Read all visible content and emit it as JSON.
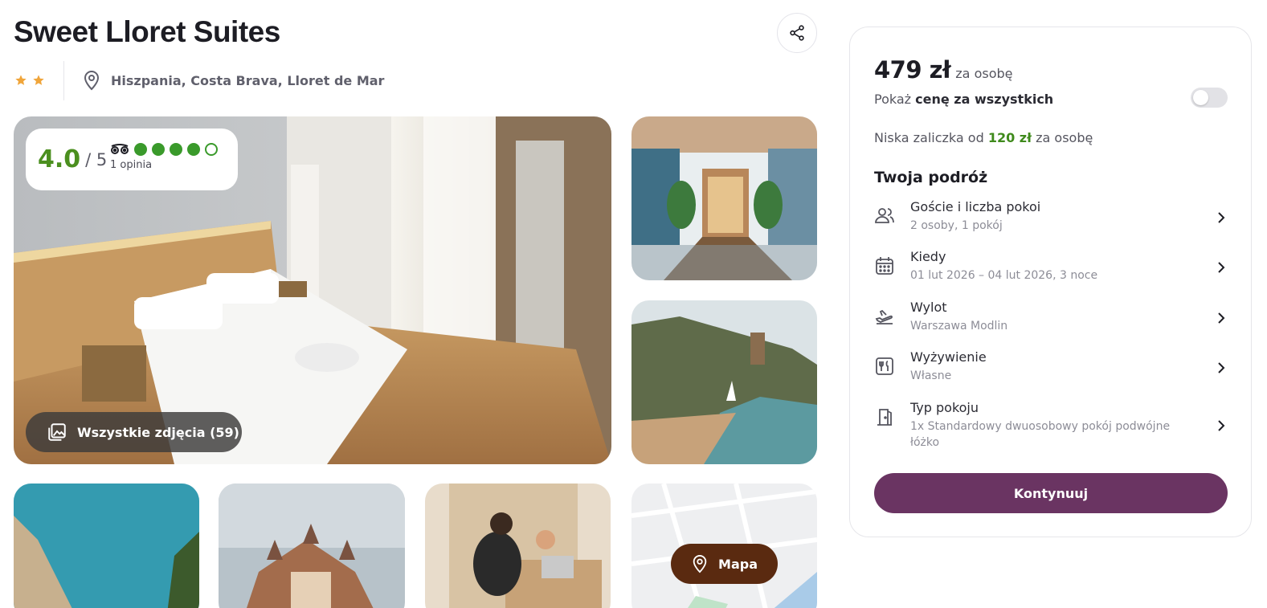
{
  "header": {
    "hotel_name": "Sweet Lloret Suites",
    "star_count": 2,
    "location": "Hiszpania, Costa Brava, Lloret de Mar"
  },
  "gallery": {
    "rating_value": "4.0",
    "rating_scale": "/ 5",
    "tripadvisor_bubbles": 4,
    "tripadvisor_reviews": "1 opinia",
    "all_photos_label": "Wszystkie zdjęcia (59)",
    "map_label": "Mapa"
  },
  "booking": {
    "price": "479 zł",
    "price_unit": "za osobę",
    "toggle_prefix": "Pokaż ",
    "toggle_bold": "cenę za wszystkich",
    "toggle_on": false,
    "deposit_prefix": "Niska zaliczka od ",
    "deposit_amount": "120 zł",
    "deposit_suffix": " za osobę",
    "trip_heading": "Twoja podróż",
    "items": [
      {
        "title": "Goście i liczba pokoi",
        "value": "2 osoby, 1 pokój",
        "icon": "guests-icon"
      },
      {
        "title": "Kiedy",
        "value": "01 lut 2026 – 04 lut 2026, 3 noce",
        "icon": "calendar-icon"
      },
      {
        "title": "Wylot",
        "value": "Warszawa Modlin",
        "icon": "plane-icon"
      },
      {
        "title": "Wyżywienie",
        "value": "Własne",
        "icon": "meal-icon"
      },
      {
        "title": "Typ pokoju",
        "value": "1x Standardowy dwuosobowy pokój podwójne łóżko",
        "icon": "door-icon"
      }
    ],
    "continue_label": "Kontynuuj"
  },
  "colors": {
    "accent_purple": "#6a3462",
    "rating_green": "#4b8f1f",
    "map_button_brown": "#5a2a10",
    "star_gold": "#f0a53a"
  }
}
